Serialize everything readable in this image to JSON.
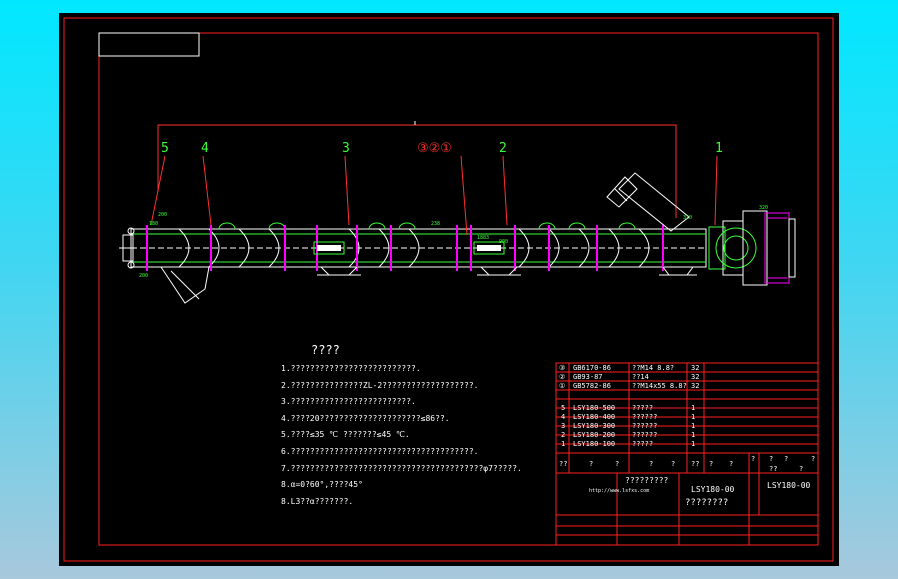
{
  "drawing": {
    "callouts": [
      "5",
      "4",
      "3",
      "③②①",
      "2",
      "1"
    ],
    "dims": [
      "200",
      "180",
      "200",
      "238",
      "1883",
      "900",
      "320",
      "320"
    ],
    "notes_title": "????",
    "notes": [
      "1.??????????????????????????.",
      "2.???????????????ZL-2???????????????????.",
      "3.?????????????????????????.",
      "4.????20?????????????????????≤86??.",
      "5.????≤35 ℃ ???????≤45 ℃.",
      "6.??????????????????????????????????????.",
      "7.????????????????????????????????????????φ7?????.",
      "8.α=0?60°,????45°",
      "8.L3??α???????."
    ]
  },
  "bom": {
    "rows": [
      {
        "no": "③",
        "code": "GB6170-86",
        "name": "??M14  8.8?",
        "qty": "32"
      },
      {
        "no": "②",
        "code": "GB93-87",
        "name": "??14",
        "qty": "32"
      },
      {
        "no": "①",
        "code": "GB5782-86",
        "name": "??M14x55  8.8?",
        "qty": "32"
      },
      {
        "no": "5",
        "code": "LSY180-500",
        "name": "?????",
        "qty": "1"
      },
      {
        "no": "4",
        "code": "LSY180-400",
        "name": "??????",
        "qty": "1"
      },
      {
        "no": "3",
        "code": "LSY180-300",
        "name": "??????",
        "qty": "1"
      },
      {
        "no": "2",
        "code": "LSY180-200",
        "name": "??????",
        "qty": "1"
      },
      {
        "no": "1",
        "code": "LSY180-100",
        "name": "?????",
        "qty": "1"
      }
    ],
    "header": [
      "??",
      "?",
      "?",
      "?",
      "?",
      "??",
      "?",
      "?",
      "?",
      "?",
      "?",
      "??",
      "?",
      "?"
    ],
    "title_code": "LSY180-00",
    "title_code2": "LSY180-00",
    "title_name": "????????",
    "company": "?????????",
    "url": "http://www.lsfxs.com"
  },
  "colors": {
    "frame": "#ff2020",
    "drawing": "#37ff37",
    "background": "#000000",
    "magenta": "#ff00ff"
  }
}
